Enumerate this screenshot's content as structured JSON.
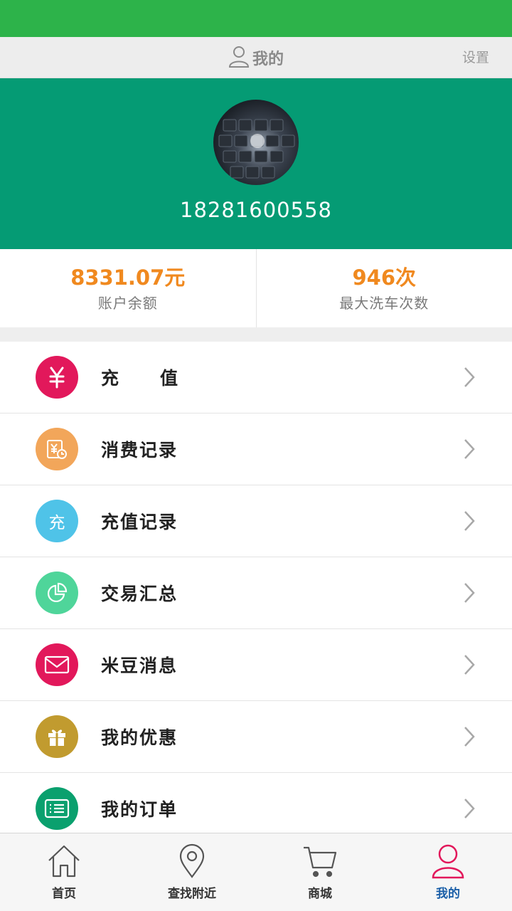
{
  "header": {
    "title": "我的",
    "settings_label": "设置"
  },
  "profile": {
    "phone": "18281600558"
  },
  "stats": [
    {
      "value": "8331.07元",
      "label": "账户余额"
    },
    {
      "value": "946次",
      "label": "最大洗车次数"
    }
  ],
  "menu": [
    {
      "label": "充值",
      "icon": "yuan-icon",
      "color": "#e2185b"
    },
    {
      "label": "消费记录",
      "icon": "receipt-icon",
      "color": "#f2a65a"
    },
    {
      "label": "充值记录",
      "icon": "recharge-icon",
      "icon_text": "充",
      "color": "#4fc3e8"
    },
    {
      "label": "交易汇总",
      "icon": "pie-chart-icon",
      "color": "#4fd59a"
    },
    {
      "label": "米豆消息",
      "icon": "mail-icon",
      "color": "#e2185b"
    },
    {
      "label": "我的优惠",
      "icon": "gift-icon",
      "color": "#c19b2f"
    },
    {
      "label": "我的订单",
      "icon": "list-icon",
      "color": "#0aa06e"
    }
  ],
  "tabs": [
    {
      "label": "首页",
      "icon": "home-icon"
    },
    {
      "label": "查找附近",
      "icon": "location-pin-icon"
    },
    {
      "label": "商城",
      "icon": "cart-icon"
    },
    {
      "label": "我的",
      "icon": "user-icon",
      "active": true
    }
  ],
  "colors": {
    "status_bar": "#2db34a",
    "profile_bg": "#059b74",
    "accent_orange": "#f0891f",
    "active_tab": "#1b5fa8",
    "active_tab_icon": "#e2185b"
  }
}
